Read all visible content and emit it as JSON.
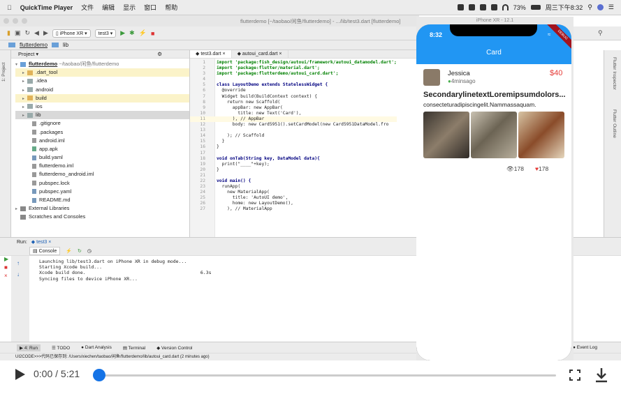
{
  "menubar": {
    "app": "QuickTime Player",
    "items": [
      "文件",
      "编辑",
      "显示",
      "窗口",
      "帮助"
    ],
    "battery": "73%",
    "clock": "周三下午8:32"
  },
  "window": {
    "title": "flutterdemo [~/taobao/闲鱼/flutterdemo] - .../lib/test3.dart [flutterdemo]"
  },
  "toolbar": {
    "device": "iPhone XR",
    "config": "test3"
  },
  "breadcrumb": [
    "flutterdemo",
    "lib"
  ],
  "project": {
    "header": "Project",
    "root": "flutterdemo",
    "root_path": "~/taobao/闲鱼/flutterdemo",
    "items": [
      ".dart_tool",
      ".idea",
      "android",
      "build",
      "ios",
      "lib",
      ".gitignore",
      ".packages",
      "android.iml",
      "app.apk",
      "build.yaml",
      "flutterdemo.iml",
      "flutterdemo_android.iml",
      "pubspec.lock",
      "pubspec.yaml",
      "README.md",
      "External Libraries",
      "Scratches and Consoles"
    ]
  },
  "editor": {
    "tabs": [
      "test3.dart",
      "autoui_card.dart"
    ],
    "lines": [
      {
        "n": "1",
        "t": "import 'package:fish_design/autoui/framework/autoui_datamodel.dart';"
      },
      {
        "n": "2",
        "t": "import 'package:flutter/material.dart';"
      },
      {
        "n": "3",
        "t": "import 'package:flutterdemo/autoui_card.dart';"
      },
      {
        "n": "4",
        "t": ""
      },
      {
        "n": "5",
        "t": "class LayoutDemo extends StatelessWidget {"
      },
      {
        "n": "6",
        "t": "  @override"
      },
      {
        "n": "7",
        "t": "  Widget build(BuildContext context) {"
      },
      {
        "n": "8",
        "t": "    return new Scaffold("
      },
      {
        "n": "9",
        "t": "      appBar: new AppBar("
      },
      {
        "n": "10",
        "t": "        title: new Text('Card'),"
      },
      {
        "n": "11",
        "t": "      ), // AppBar"
      },
      {
        "n": "12",
        "t": "      body: new Card5951().setCardModel(new Card5951DataModel.fro"
      },
      {
        "n": "13",
        "t": ""
      },
      {
        "n": "14",
        "t": "    ); // Scaffold"
      },
      {
        "n": "15",
        "t": "  }"
      },
      {
        "n": "16",
        "t": "}"
      },
      {
        "n": "17",
        "t": ""
      },
      {
        "n": "18",
        "t": "void onTab(String key, DataModel data){"
      },
      {
        "n": "19",
        "t": "  print(\"____\"+key);"
      },
      {
        "n": "20",
        "t": "}"
      },
      {
        "n": "21",
        "t": ""
      },
      {
        "n": "22",
        "t": "void main() {"
      },
      {
        "n": "23",
        "t": "  runApp("
      },
      {
        "n": "24",
        "t": "    new MaterialApp("
      },
      {
        "n": "25",
        "t": "      title: 'AutoUI demo',"
      },
      {
        "n": "26",
        "t": "      home: new LayoutDemo(),"
      },
      {
        "n": "27",
        "t": "    ), // MaterialApp"
      }
    ]
  },
  "run": {
    "label": "Run:",
    "config": "test3",
    "console_tab": "Console",
    "lines": [
      "Launching lib/test3.dart on iPhone XR in debug mode...",
      "Starting Xcode build...",
      "Xcode build done.                                          6.3s",
      "Syncing files to device iPhone XR..."
    ]
  },
  "bottom_tools": [
    "4: Run",
    "TODO",
    "Dart Analysis",
    "Terminal",
    "Version Control",
    "Event Log"
  ],
  "status": "UI2CODE>>>代码已保存到: /Users/xiechen/taobao/闲鱼/flutterdemo/lib/autoui_card.dart (2 minutes ago)",
  "simulator": {
    "title": "iPhone XR - 12.1",
    "time": "8:32",
    "app_title": "Card",
    "debug_banner": "DEBUG",
    "card": {
      "name": "Jessica",
      "time": "4minsago",
      "price": "$40",
      "title": "SecondarylinetextLoremipsumdolors...",
      "subtitle": "consecteturadipiscingelit.Nammassaquam.",
      "views": "178",
      "likes": "178"
    }
  },
  "video": {
    "time": "0:00 / 5:21",
    "progress": 0.0
  }
}
